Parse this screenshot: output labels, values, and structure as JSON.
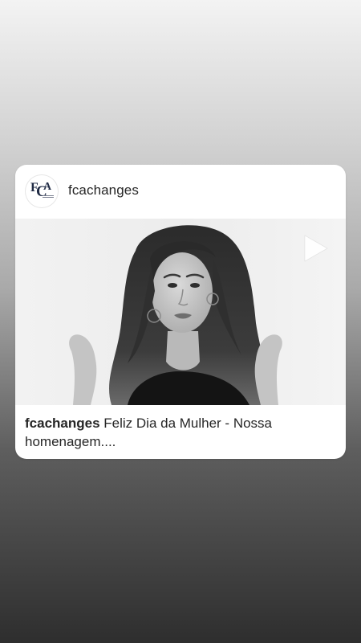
{
  "post": {
    "username": "fcachanges",
    "avatar": {
      "letters": [
        "F",
        "C",
        "A"
      ],
      "color": "#1f2a44"
    },
    "caption_user": "fcachanges",
    "caption_text": " Feliz Dia da Mulher - Nossa homenagem...."
  },
  "icons": {
    "play": "play-icon"
  },
  "colors": {
    "card_background": "#ffffff",
    "text_primary": "#262626"
  }
}
